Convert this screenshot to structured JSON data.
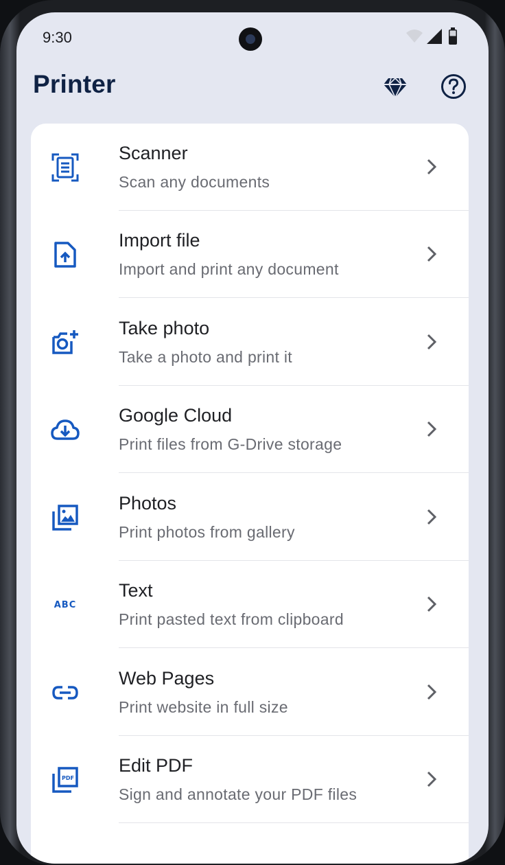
{
  "status_bar": {
    "time": "9:30"
  },
  "header": {
    "title": "Printer",
    "premium_icon": "diamond-icon",
    "help_icon": "help-circle-icon"
  },
  "accent_color": "#1659c0",
  "menu": [
    {
      "title": "Scanner",
      "subtitle": "Scan any documents",
      "icon": "scanner-icon"
    },
    {
      "title": "Import file",
      "subtitle": "Import and print any document",
      "icon": "file-upload-icon"
    },
    {
      "title": "Take photo",
      "subtitle": "Take a photo and print it",
      "icon": "camera-add-icon"
    },
    {
      "title": "Google Cloud",
      "subtitle": "Print files from G-Drive storage",
      "icon": "cloud-download-icon"
    },
    {
      "title": "Photos",
      "subtitle": "Print photos from gallery",
      "icon": "photo-library-icon"
    },
    {
      "title": "Text",
      "subtitle": "Print pasted text from clipboard",
      "icon": "abc-icon",
      "icon_text": "ABC"
    },
    {
      "title": "Web Pages",
      "subtitle": "Print website in full size",
      "icon": "link-icon"
    },
    {
      "title": "Edit PDF",
      "subtitle": "Sign and annotate your PDF files",
      "icon": "pdf-icon",
      "icon_text": "PDF"
    }
  ]
}
